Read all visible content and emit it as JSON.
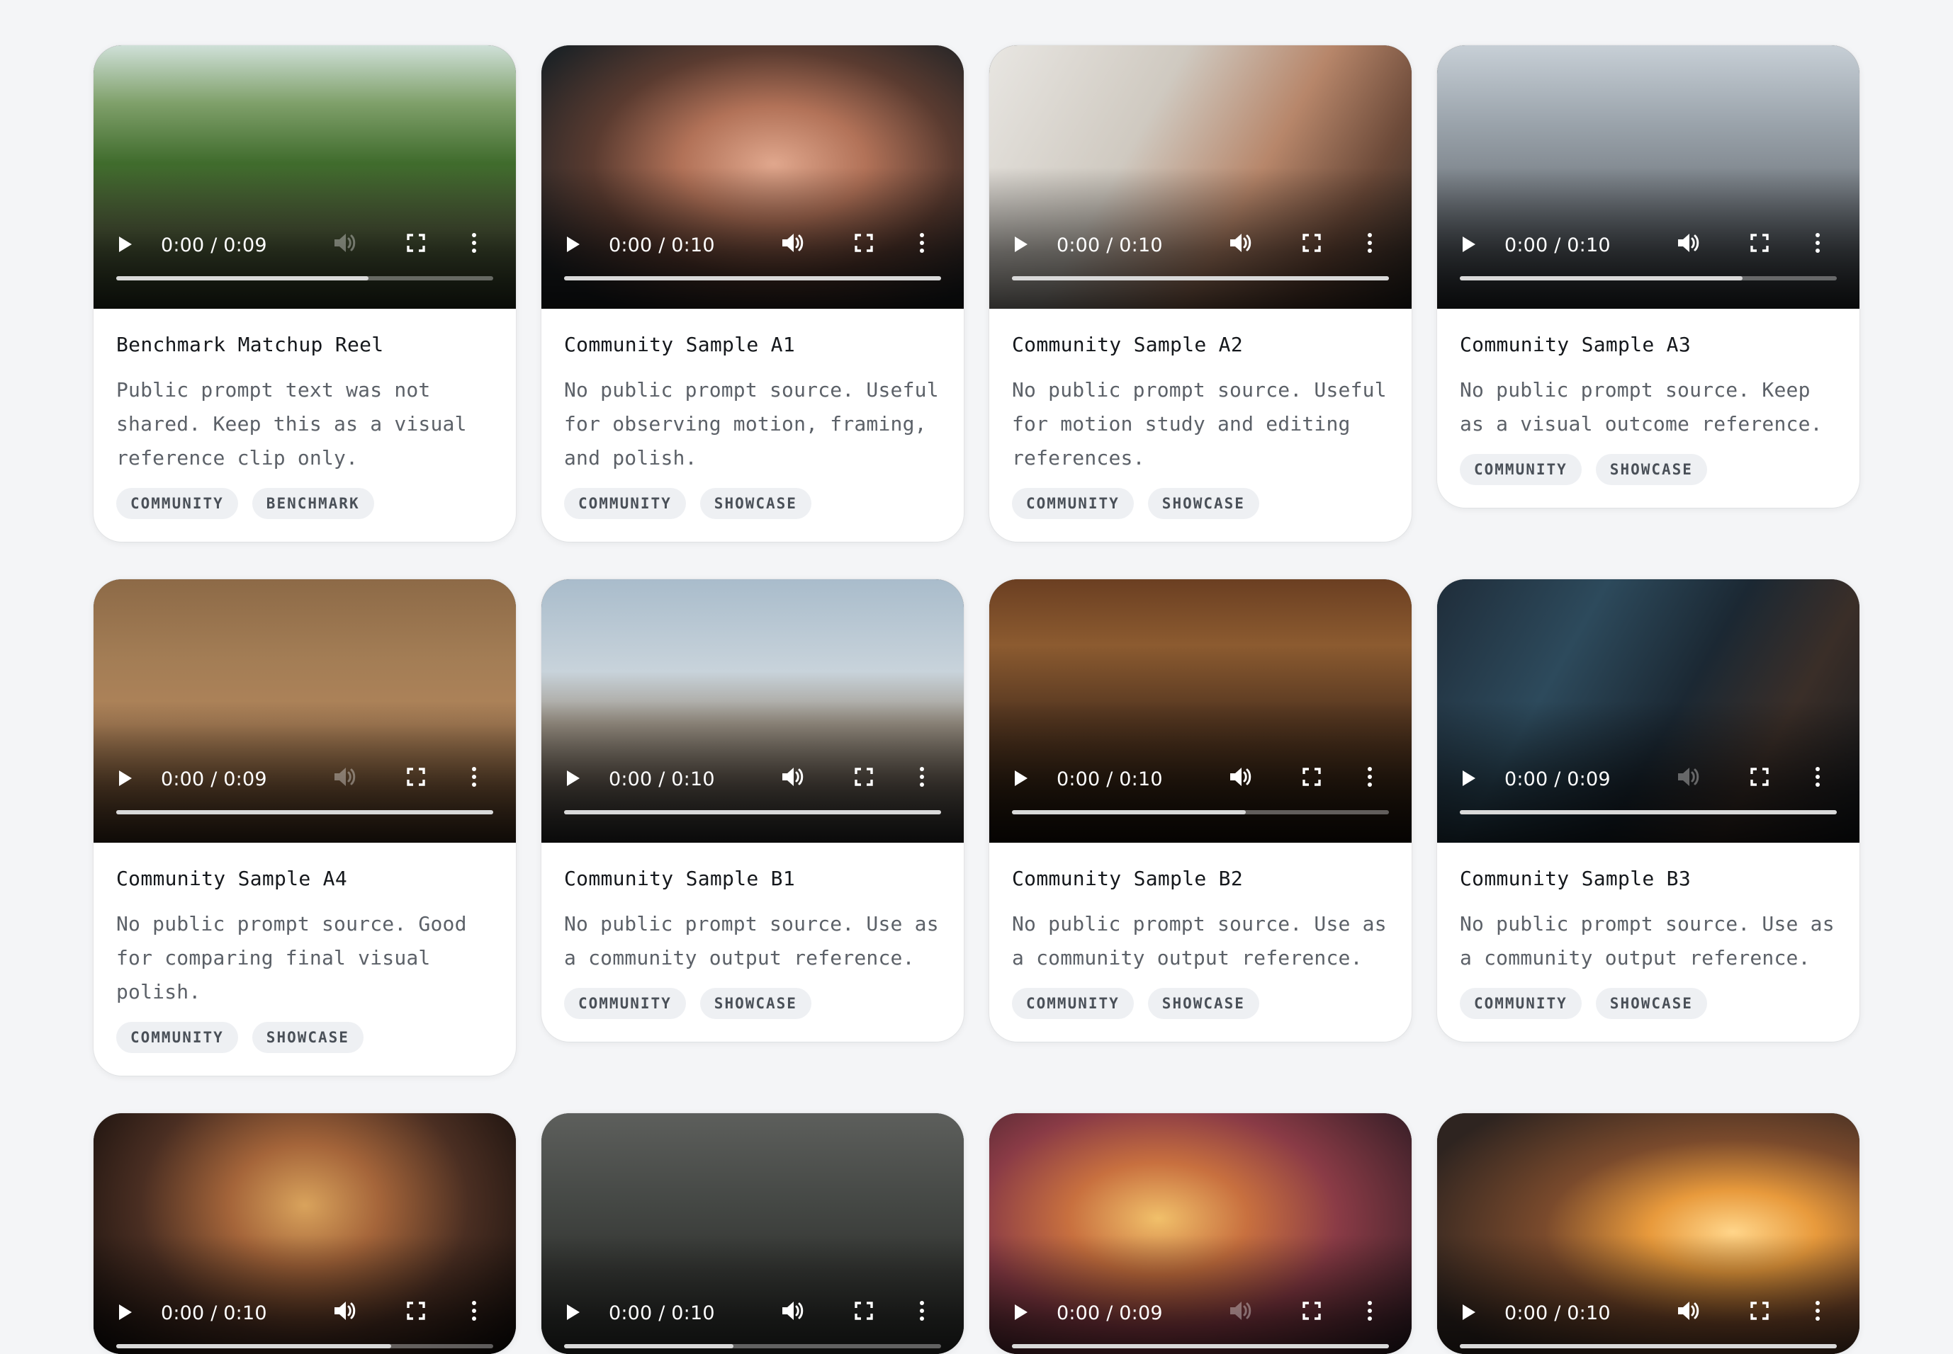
{
  "cards": [
    {
      "title": "Benchmark Matchup Reel",
      "description": "Public prompt text was not shared. Keep this as a visual reference clip only.",
      "time": "0:00 / 0:09",
      "progress": 0.67,
      "muted": true,
      "tags": [
        "COMMUNITY",
        "BENCHMARK"
      ]
    },
    {
      "title": "Community Sample A1",
      "description": "No public prompt source. Useful for observing motion, framing, and polish.",
      "time": "0:00 / 0:10",
      "progress": 1.0,
      "muted": false,
      "tags": [
        "COMMUNITY",
        "SHOWCASE"
      ]
    },
    {
      "title": "Community Sample A2",
      "description": "No public prompt source. Useful for motion study and editing references.",
      "time": "0:00 / 0:10",
      "progress": 1.0,
      "muted": false,
      "tags": [
        "COMMUNITY",
        "SHOWCASE"
      ]
    },
    {
      "title": "Community Sample A3",
      "description": "No public prompt source. Keep as a visual outcome reference.",
      "time": "0:00 / 0:10",
      "progress": 0.75,
      "muted": false,
      "tags": [
        "COMMUNITY",
        "SHOWCASE"
      ]
    },
    {
      "title": "Community Sample A4",
      "description": "No public prompt source. Good for comparing final visual polish.",
      "time": "0:00 / 0:09",
      "progress": 1.0,
      "muted": true,
      "tags": [
        "COMMUNITY",
        "SHOWCASE"
      ]
    },
    {
      "title": "Community Sample B1",
      "description": "No public prompt source. Use as a community output reference.",
      "time": "0:00 / 0:10",
      "progress": 1.0,
      "muted": false,
      "tags": [
        "COMMUNITY",
        "SHOWCASE"
      ]
    },
    {
      "title": "Community Sample B2",
      "description": "No public prompt source. Use as a community output reference.",
      "time": "0:00 / 0:10",
      "progress": 0.62,
      "muted": false,
      "tags": [
        "COMMUNITY",
        "SHOWCASE"
      ]
    },
    {
      "title": "Community Sample B3",
      "description": "No public prompt source. Use as a community output reference.",
      "time": "0:00 / 0:09",
      "progress": 1.0,
      "muted": true,
      "tags": [
        "COMMUNITY",
        "SHOWCASE"
      ]
    },
    {
      "title": "",
      "description": "",
      "time": "0:00 / 0:10",
      "progress": 0.73,
      "muted": false,
      "tags": []
    },
    {
      "title": "",
      "description": "",
      "time": "0:00 / 0:10",
      "progress": 0.45,
      "muted": false,
      "tags": []
    },
    {
      "title": "",
      "description": "",
      "time": "0:00 / 0:09",
      "progress": 1.0,
      "muted": true,
      "tags": []
    },
    {
      "title": "",
      "description": "",
      "time": "0:00 / 0:10",
      "progress": 1.0,
      "muted": false,
      "tags": []
    }
  ]
}
